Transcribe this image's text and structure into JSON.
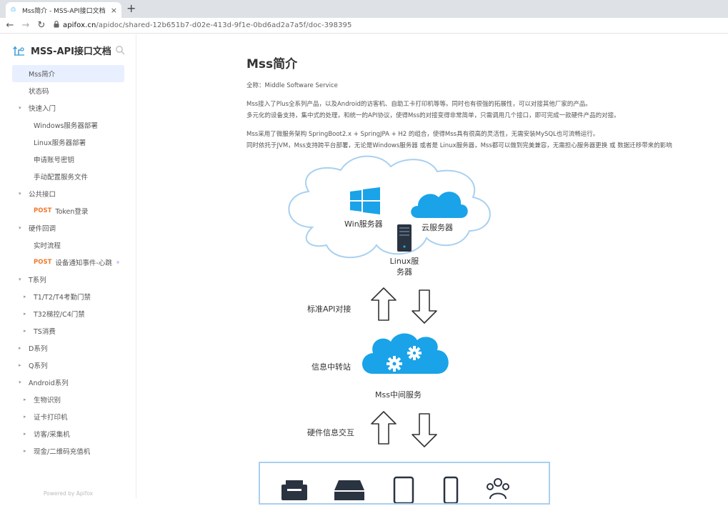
{
  "browser": {
    "tab_title": "Mss简介 - MSS-API接口文档",
    "tab_close": "×",
    "new_tab": "+",
    "nav_back": "←",
    "nav_forward": "→",
    "nav_reload": "↻",
    "url_domain": "apifox.cn",
    "url_path": "/apidoc/shared-12b651b7-d02e-413d-9f1e-0bd6ad2a7a5f/doc-398395"
  },
  "sidebar": {
    "title": "MSS-API接口文档",
    "powered_by": "Powered by Apifox",
    "items": [
      {
        "label": "Mss简介",
        "level": 0,
        "active": true,
        "caret": "",
        "method": ""
      },
      {
        "label": "状态码",
        "level": 0,
        "active": false,
        "caret": "",
        "method": ""
      },
      {
        "label": "快速入门",
        "level": 0,
        "active": false,
        "caret": "▾",
        "method": ""
      },
      {
        "label": "Windows服务器部署",
        "level": 1,
        "active": false,
        "caret": "",
        "method": ""
      },
      {
        "label": "Linux服务器部署",
        "level": 1,
        "active": false,
        "caret": "",
        "method": ""
      },
      {
        "label": "申请账号密钥",
        "level": 1,
        "active": false,
        "caret": "",
        "method": ""
      },
      {
        "label": "手动配置服务文件",
        "level": 1,
        "active": false,
        "caret": "",
        "method": ""
      },
      {
        "label": "公共接口",
        "level": 0,
        "active": false,
        "caret": "▾",
        "method": ""
      },
      {
        "label": "Token登录",
        "level": 1,
        "active": false,
        "caret": "",
        "method": "POST"
      },
      {
        "label": "硬件回调",
        "level": 0,
        "active": false,
        "caret": "▾",
        "method": ""
      },
      {
        "label": "实时流程",
        "level": 1,
        "active": false,
        "caret": "",
        "method": ""
      },
      {
        "label": "设备通知事件-心跳",
        "level": 1,
        "active": false,
        "caret": "",
        "method": "POST",
        "dot": true
      },
      {
        "label": "T系列",
        "level": 0,
        "active": false,
        "caret": "▾",
        "method": ""
      },
      {
        "label": "T1/T2/T4考勤门禁",
        "level": 1,
        "active": false,
        "caret": "▸",
        "method": ""
      },
      {
        "label": "T32梯控/C4门禁",
        "level": 1,
        "active": false,
        "caret": "▸",
        "method": ""
      },
      {
        "label": "TS消费",
        "level": 1,
        "active": false,
        "caret": "▸",
        "method": ""
      },
      {
        "label": "D系列",
        "level": 0,
        "active": false,
        "caret": "▸",
        "method": ""
      },
      {
        "label": "Q系列",
        "level": 0,
        "active": false,
        "caret": "▸",
        "method": ""
      },
      {
        "label": "Android系列",
        "level": 0,
        "active": false,
        "caret": "▾",
        "method": ""
      },
      {
        "label": "生物识别",
        "level": 1,
        "active": false,
        "caret": "▸",
        "method": ""
      },
      {
        "label": "证卡打印机",
        "level": 1,
        "active": false,
        "caret": "▸",
        "method": ""
      },
      {
        "label": "访客/采集机",
        "level": 1,
        "active": false,
        "caret": "▸",
        "method": ""
      },
      {
        "label": "现金/二维码充值机",
        "level": 1,
        "active": false,
        "caret": "▸",
        "method": ""
      }
    ]
  },
  "doc": {
    "title": "Mss简介",
    "fullname": "全称：Middle Software Service",
    "p1_line1": "Mss接入了Plus全系列产品，以及Android的访客机、自助工卡打印机等等。同时也有很强的拓展性，可以对接其他厂家的产品。",
    "p1_line2": "多元化的设备支持，集中式的处理，和统一的API协议，使得Mss的对接变得非常简单，只需调用几个接口，即可完成一款硬件产品的对接。",
    "p2_line1": "Mss采用了微服务架构 SpringBoot2.x + SpringJPA + H2 的组合，使得Mss具有很高的灵活性，无需安装MySQL也可流畅运行。",
    "p2_line2": "同时依托于JVM，Mss支持跨平台部署，无论是Windows服务器 或者是 Linux服务器，Mss都可以做到完美兼容，无需担心服务器更换 或 数据迁移带来的影响"
  },
  "diagram": {
    "win_server": "Win服务器",
    "cloud_server": "云服务器",
    "linux_line1": "Linux服",
    "linux_line2": "务器",
    "api_label": "标准API对接",
    "relay_label": "信息中转站",
    "mss_middle": "Mss中间服务",
    "hw_label": "硬件信息交互"
  }
}
